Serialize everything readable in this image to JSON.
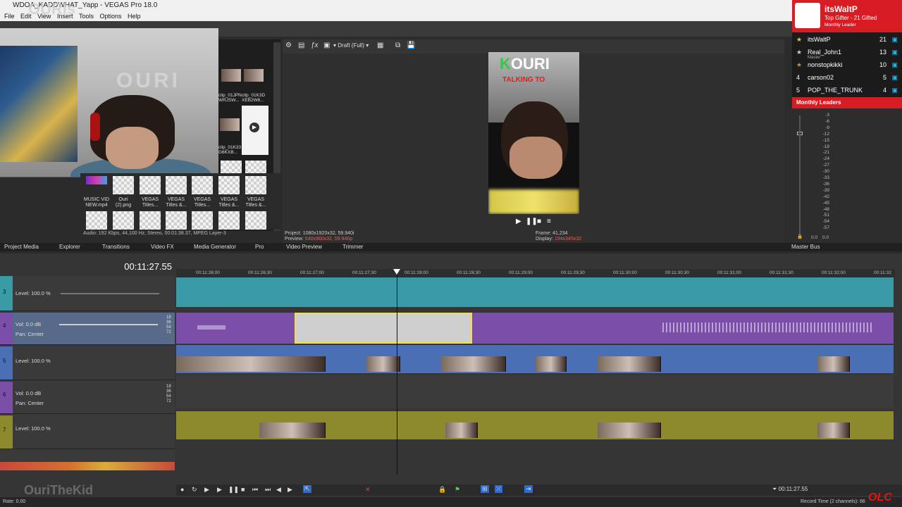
{
  "window": {
    "title": "WDOA_KADDWHAT_Yapp - VEGAS Pro 18.0",
    "watermark_top": "OURIs"
  },
  "menu": [
    "File",
    "Edit",
    "View",
    "Insert",
    "Tools",
    "Options",
    "Help"
  ],
  "media": {
    "clips_right": [
      {
        "label": "clip_01JPN\nWRJSW..."
      },
      {
        "label": "clip_01K3D\nXEB2W6..."
      },
      {
        "label": "clip_01K33\nG6KXB..."
      }
    ],
    "items": [
      {
        "label": "MUSIC VID\nNEW.mp4"
      },
      {
        "label": "Ouri\n(2).png"
      },
      {
        "label": "VEGAS\nTitles..."
      },
      {
        "label": "VEGAS\nTitles &..."
      },
      {
        "label": "VEGAS\nTitles..."
      },
      {
        "label": "VEGAS\nTitles &..."
      },
      {
        "label": "VEGAS\nTitles &..."
      }
    ],
    "status": "Audio: 192 Kbps, 44,100 Hz, Stereo, 00:01:38.37, MPEG Layer-3"
  },
  "preview": {
    "quality": "Draft (Full)",
    "overlay_title_k": "K",
    "overlay_title_rest": "OURI",
    "overlay_subtitle": "TALKING TO",
    "project_label": "Project:",
    "project_value": "1080x1920x32, 59.940i",
    "preview_label": "Preview:",
    "preview_value": "540x960x32, 59.940p",
    "frame_label": "Frame:",
    "frame_value": "41,234",
    "display_label": "Display:",
    "display_value": "194x345x32"
  },
  "leaderboard": {
    "header_name": "itsWaltP",
    "header_sub": "Top Gifter - 21 Gifted",
    "header_period": "Monthly Leader",
    "rows": [
      {
        "rank": "",
        "user": "itsWaltP",
        "count": "21"
      },
      {
        "rank": "",
        "user": "Real_John1",
        "count": "13"
      },
      {
        "rank": "",
        "user": "nonstopkikki",
        "count": "10"
      },
      {
        "rank": "4",
        "user": "carson02",
        "count": "5"
      },
      {
        "rank": "5",
        "user": "POP_THE_TRUNK",
        "count": "4"
      }
    ],
    "footer": "Monthly Leaders"
  },
  "master_bus": {
    "label": "Master",
    "db_scale": [
      "-3",
      "-6",
      "-9",
      "-12",
      "-15",
      "-18",
      "-21",
      "-24",
      "-27",
      "-30",
      "-33",
      "-36",
      "-39",
      "-42",
      "-45",
      "-48",
      "-51",
      "-54",
      "-57"
    ],
    "bottom_left": "0.0",
    "bottom_right": "0.0"
  },
  "dock_tabs": [
    "Project Media",
    "Explorer",
    "Transitions",
    "Video FX",
    "Media Generator",
    "Pro",
    "Video Preview",
    "Trimmer",
    "Master Bus"
  ],
  "timeline": {
    "current_time": "00:11:27.55",
    "ruler_ticks": [
      "00:11:26;00",
      "00:11:26;30",
      "00:11:27;00",
      "00:11:27;30",
      "00:11:28;00",
      "00:11:28;30",
      "00:11:29;00",
      "00:11:29;30",
      "00:11:30;00",
      "00:11:30;30",
      "00:11:31;00",
      "00:11:31;30",
      "00:11:32;00",
      "00:11:32"
    ],
    "tracks": [
      {
        "num": "3",
        "line1": "Level: 100.0 %",
        "line2": ""
      },
      {
        "num": "4",
        "line1": "Vol:      0.0 dB",
        "line2": "Pan:      Center"
      },
      {
        "num": "5",
        "line1": "Level: 100.0 %",
        "line2": ""
      },
      {
        "num": "6",
        "line1": "Vol:      0.0 dB",
        "line2": "Pan:      Center"
      },
      {
        "num": "7",
        "line1": "Level: 100.0 %",
        "line2": ""
      }
    ],
    "db_marks": [
      "18",
      "36",
      "54",
      "72"
    ],
    "end_time": "00:11:27.55",
    "rate": "Rate: 0.00",
    "record_time": "Record Time (2 channels): 66",
    "watermark": "OuriTheKid",
    "olc": "OLC"
  },
  "colors": {
    "teal_track": "#3a9aa6",
    "purple_track": "#7b4fa8",
    "blue_track": "#4a6fb5",
    "olive_track": "#8d8a2e",
    "leader_red": "#d81c24",
    "selection_yellow": "#f2e23a"
  }
}
